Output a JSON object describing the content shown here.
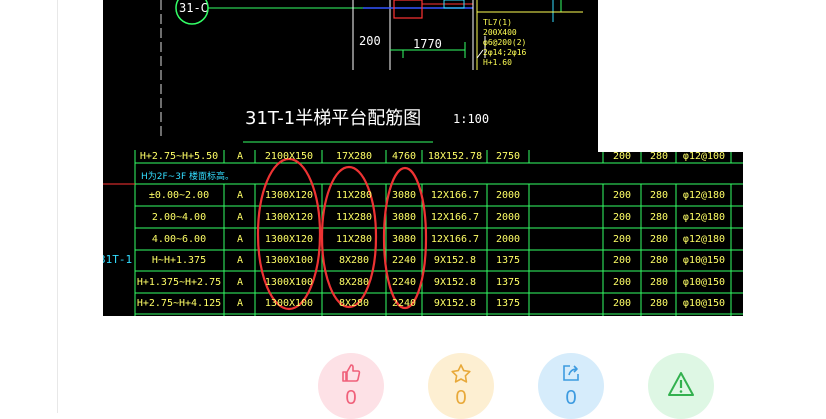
{
  "drawing": {
    "axis_label": "31-C",
    "dim_200": "200",
    "dim_1770": "1770",
    "tl_note": [
      "TL7(1)",
      "200X400",
      "φ6@200(2)",
      "2φ14;2φ16",
      "H+1.60"
    ],
    "title": "31T-1半梯平台配筋图",
    "scale": "1:100"
  },
  "table": {
    "top_row": [
      "H+2.75~H+5.50",
      "A",
      "2100X150",
      "17X280",
      "4760",
      "18X152.78",
      "2750",
      "200",
      "280",
      "φ12@100"
    ],
    "section_note": "H为2F~3F 楼面标高。",
    "side_label": "31T-1",
    "rows": [
      [
        "±0.00~2.00",
        "A",
        "1300X120",
        "11X280",
        "3080",
        "12X166.7",
        "2000",
        "200",
        "280",
        "φ12@180"
      ],
      [
        "2.00~4.00",
        "A",
        "1300X120",
        "11X280",
        "3080",
        "12X166.7",
        "2000",
        "200",
        "280",
        "φ12@180"
      ],
      [
        "4.00~6.00",
        "A",
        "1300X120",
        "11X280",
        "3080",
        "12X166.7",
        "2000",
        "200",
        "280",
        "φ12@180"
      ],
      [
        "H~H+1.375",
        "A",
        "1300X100",
        "8X280",
        "2240",
        "9X152.8",
        "1375",
        "200",
        "280",
        "φ10@150"
      ],
      [
        "H+1.375~H+2.75",
        "A",
        "1300X100",
        "8X280",
        "2240",
        "9X152.8",
        "1375",
        "200",
        "280",
        "φ10@150"
      ],
      [
        "H+2.75~H+4.125",
        "A",
        "1300X100",
        "8X280",
        "2240",
        "9X152.8",
        "1375",
        "200",
        "280",
        "φ10@150"
      ]
    ]
  },
  "actions": [
    {
      "name": "like",
      "icon": "thumbs-up-icon",
      "count": "0",
      "bg": "#fde1e6",
      "fg": "#f0607a"
    },
    {
      "name": "favorite",
      "icon": "star-icon",
      "count": "0",
      "bg": "#fdefd2",
      "fg": "#e8a93a"
    },
    {
      "name": "share",
      "icon": "share-icon",
      "count": "0",
      "bg": "#d6ecfb",
      "fg": "#3d9be0"
    },
    {
      "name": "report",
      "icon": "warning-icon",
      "count": "",
      "bg": "#def7e4",
      "fg": "#33b14f"
    }
  ]
}
